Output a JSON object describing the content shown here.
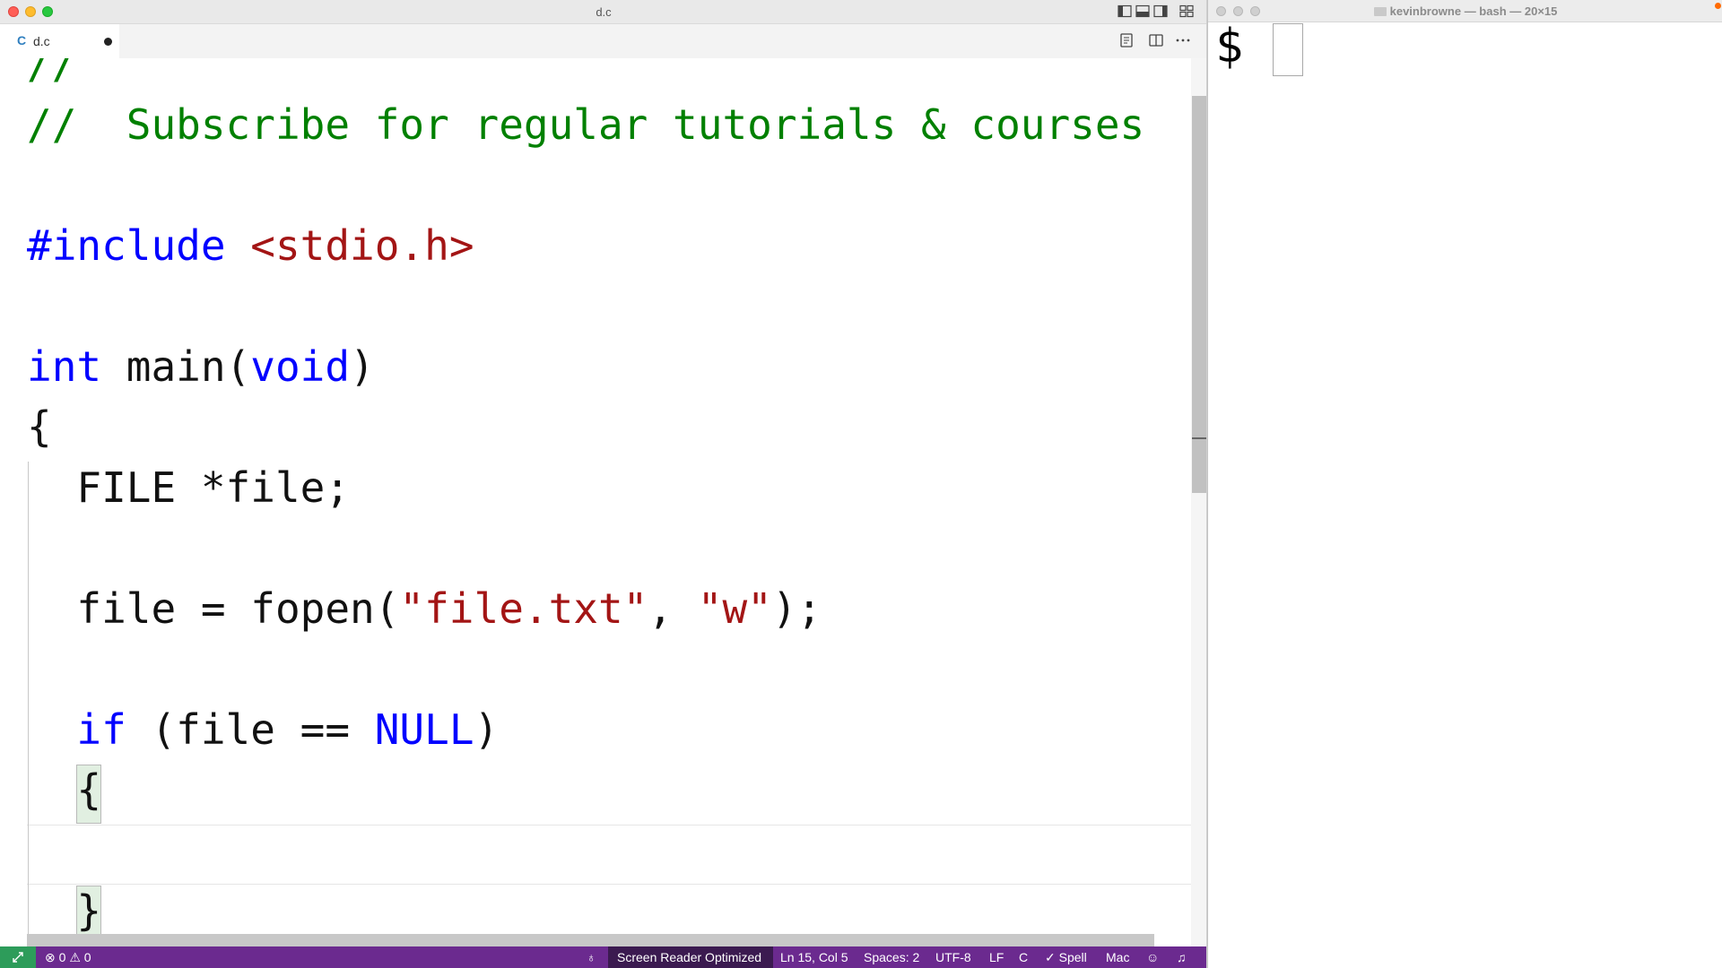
{
  "editor_window": {
    "title": "d.c",
    "tab": {
      "lang_icon": "C",
      "label": "d.c",
      "dirty": true
    },
    "code_lines": [
      [
        {
          "t": "//",
          "c": "comment"
        }
      ],
      [
        {
          "t": "//  Subscribe for regular tutorials & courses",
          "c": "comment"
        }
      ],
      [],
      [
        {
          "t": "#include",
          "c": "kw"
        },
        {
          "t": " ",
          "c": "plain"
        },
        {
          "t": "<stdio.h>",
          "c": "str"
        }
      ],
      [],
      [
        {
          "t": "int",
          "c": "kw"
        },
        {
          "t": " main(",
          "c": "plain"
        },
        {
          "t": "void",
          "c": "kw"
        },
        {
          "t": ")",
          "c": "plain"
        }
      ],
      [
        {
          "t": "{",
          "c": "plain"
        }
      ],
      [
        {
          "t": "  FILE *file;",
          "c": "plain"
        }
      ],
      [],
      [
        {
          "t": "  file = fopen(",
          "c": "plain"
        },
        {
          "t": "\"file.txt\"",
          "c": "str"
        },
        {
          "t": ", ",
          "c": "plain"
        },
        {
          "t": "\"w\"",
          "c": "str"
        },
        {
          "t": ");",
          "c": "plain"
        }
      ],
      [],
      [
        {
          "t": "  ",
          "c": "plain"
        },
        {
          "t": "if",
          "c": "kw"
        },
        {
          "t": " (file == ",
          "c": "plain"
        },
        {
          "t": "NULL",
          "c": "kw"
        },
        {
          "t": ")",
          "c": "plain"
        }
      ],
      [
        {
          "t": "  {",
          "c": "plain"
        }
      ],
      [],
      [
        {
          "t": "  }",
          "c": "plain"
        }
      ]
    ],
    "colors": {
      "comment": "#008000",
      "keyword": "#0000ff",
      "string": "#a31515",
      "statusbar": "#6b2a8f"
    },
    "status": {
      "problems_errors": "0",
      "problems_warnings": "0",
      "screen_reader": "Screen Reader Optimized",
      "position": "Ln 15, Col 5",
      "spaces": "Spaces: 2",
      "encoding": "UTF-8",
      "eol": "LF",
      "language": "C",
      "spell": "Spell",
      "keymap": "Mac"
    }
  },
  "terminal_window": {
    "title": "kevinbrowne — bash — 20×15",
    "prompt": "$"
  }
}
